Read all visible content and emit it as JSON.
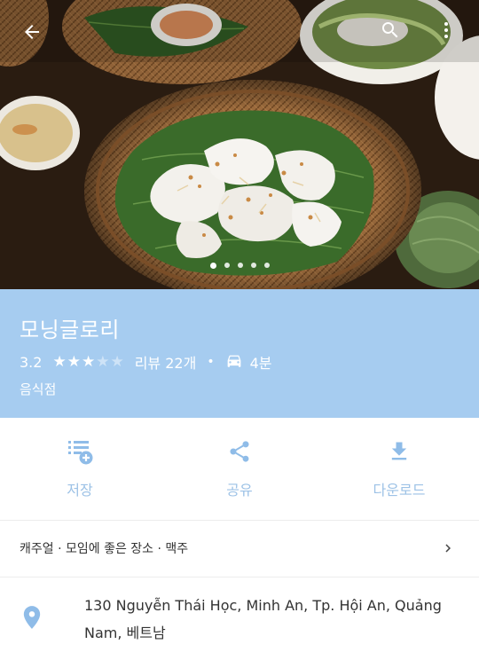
{
  "place": {
    "name": "모닝글로리",
    "rating": "3.2",
    "stars_filled": 3,
    "stars_total": 5,
    "reviews": "리뷰 22개",
    "separator": "•",
    "travel_time": "4분",
    "category": "음식점"
  },
  "photo_pager": {
    "count": 5,
    "active_index": 0
  },
  "top_bar": {
    "back_icon": "arrow-back-icon",
    "search_icon": "search-icon",
    "more_icon": "more-vertical-icon"
  },
  "actions": {
    "save": {
      "label": "저장",
      "icon": "playlist-add-icon"
    },
    "share": {
      "label": "공유",
      "icon": "share-icon"
    },
    "download": {
      "label": "다운로드",
      "icon": "download-icon"
    }
  },
  "tags": {
    "text": "캐주얼 · 모임에 좋은 장소 · 맥주"
  },
  "address": {
    "line1": "130 Nguyễn Thái Học, Minh An, Tp. Hội An, Quảng",
    "line2": "Nam, 베트남"
  },
  "colors": {
    "title_band": "#a6ccf0",
    "action_accent": "#9dc2e6",
    "pin": "#8fbce8"
  }
}
